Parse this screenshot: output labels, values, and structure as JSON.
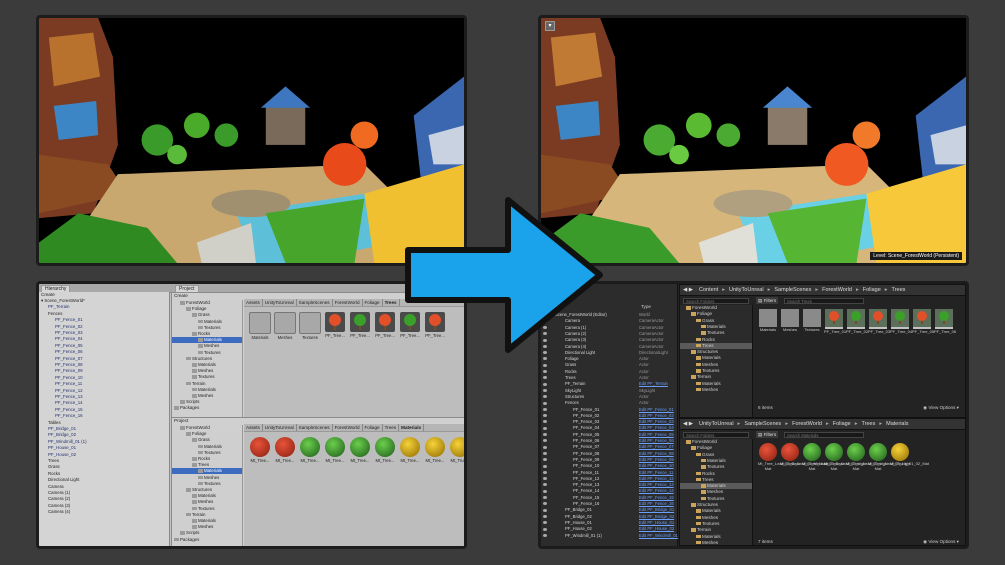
{
  "colors": {
    "background": "#3b3b3b",
    "arrow_fill": "#1aa2ea",
    "arrow_stroke": "#111111",
    "unity_bg": "#c2c2c2",
    "unreal_bg": "#262626",
    "selection": "#3d6bbf"
  },
  "viewport_right": {
    "level_label": "Level: Scene_ForestWorld (Persistent)"
  },
  "unity": {
    "hierarchy_tab": "Hierarchy",
    "create_label": "Create",
    "hierarchy": [
      {
        "label": "Scene_ForestWorld*",
        "dark": true
      },
      {
        "label": "PF_Terrain"
      },
      {
        "label": "Fences",
        "dark": true
      },
      {
        "label": "PF_Fence_01"
      },
      {
        "label": "PF_Fence_02"
      },
      {
        "label": "PF_Fence_03"
      },
      {
        "label": "PF_Fence_04"
      },
      {
        "label": "PF_Fence_05"
      },
      {
        "label": "PF_Fence_06"
      },
      {
        "label": "PF_Fence_07"
      },
      {
        "label": "PF_Fence_08"
      },
      {
        "label": "PF_Fence_09"
      },
      {
        "label": "PF_Fence_10"
      },
      {
        "label": "PF_Fence_11"
      },
      {
        "label": "PF_Fence_12"
      },
      {
        "label": "PF_Fence_13"
      },
      {
        "label": "PF_Fence_14"
      },
      {
        "label": "PF_Fence_15"
      },
      {
        "label": "PF_Fence_16"
      },
      {
        "label": "Tables",
        "dark": true
      },
      {
        "label": "PF_Bridge_01"
      },
      {
        "label": "PF_Bridge_02"
      },
      {
        "label": "PF_Windmill_01 (1)"
      },
      {
        "label": "PF_House_01"
      },
      {
        "label": "PF_House_02"
      },
      {
        "label": "Trees",
        "dark": true
      },
      {
        "label": "Grass",
        "dark": true
      },
      {
        "label": "Rocks",
        "dark": true
      },
      {
        "label": "Directional Light",
        "dark": true
      },
      {
        "label": "Camera",
        "dark": true
      },
      {
        "label": "Camera (1)",
        "dark": true
      },
      {
        "label": "Camera (2)",
        "dark": true
      },
      {
        "label": "Camera (3)",
        "dark": true
      },
      {
        "label": "Camera (4)",
        "dark": true
      }
    ],
    "project_tab": "Project",
    "project_top": {
      "tree": [
        {
          "label": "ForestWorld",
          "indent": 1
        },
        {
          "label": "Foliage",
          "indent": 2
        },
        {
          "label": "Grass",
          "indent": 3
        },
        {
          "label": "Materials",
          "indent": 4
        },
        {
          "label": "Textures",
          "indent": 4
        },
        {
          "label": "Rocks",
          "indent": 3
        },
        {
          "label": "Materials",
          "indent": 4,
          "sel": true
        },
        {
          "label": "Meshes",
          "indent": 4
        },
        {
          "label": "Textures",
          "indent": 4
        },
        {
          "label": "Structures",
          "indent": 2
        },
        {
          "label": "Materials",
          "indent": 3
        },
        {
          "label": "Meshes",
          "indent": 3
        },
        {
          "label": "Textures",
          "indent": 3
        },
        {
          "label": "Terrain",
          "indent": 2
        },
        {
          "label": "Materials",
          "indent": 3
        },
        {
          "label": "Meshes",
          "indent": 3
        },
        {
          "label": "Scripts",
          "indent": 1
        },
        {
          "label": "Packages",
          "indent": 0
        }
      ],
      "breadcrumb": [
        "Assets",
        "UnityToUnreal",
        "SampleScenes",
        "ForestWorld",
        "Foliage",
        "Trees"
      ],
      "assets": [
        {
          "label": "Materials",
          "kind": "folder"
        },
        {
          "label": "Meshes",
          "kind": "folder"
        },
        {
          "label": "Textures",
          "kind": "folder"
        },
        {
          "label": "PF_Tree...",
          "kind": "tree"
        },
        {
          "label": "PF_Tree...",
          "kind": "tree"
        },
        {
          "label": "PF_Tree...",
          "kind": "tree"
        },
        {
          "label": "PF_Tree...",
          "kind": "tree"
        },
        {
          "label": "PF_Tree...",
          "kind": "tree"
        }
      ]
    },
    "project_bottom": {
      "tree": [
        {
          "label": "ForestWorld",
          "indent": 1
        },
        {
          "label": "Foliage",
          "indent": 2
        },
        {
          "label": "Grass",
          "indent": 3
        },
        {
          "label": "Materials",
          "indent": 4
        },
        {
          "label": "Textures",
          "indent": 4
        },
        {
          "label": "Rocks",
          "indent": 3
        },
        {
          "label": "Trees",
          "indent": 3
        },
        {
          "label": "Materials",
          "indent": 4,
          "sel": true
        },
        {
          "label": "Meshes",
          "indent": 4
        },
        {
          "label": "Textures",
          "indent": 4
        },
        {
          "label": "Structures",
          "indent": 2
        },
        {
          "label": "Materials",
          "indent": 3
        },
        {
          "label": "Meshes",
          "indent": 3
        },
        {
          "label": "Textures",
          "indent": 3
        },
        {
          "label": "Terrain",
          "indent": 2
        },
        {
          "label": "Materials",
          "indent": 3
        },
        {
          "label": "Meshes",
          "indent": 3
        },
        {
          "label": "Scripts",
          "indent": 1
        },
        {
          "label": "Packages",
          "indent": 0
        }
      ],
      "breadcrumb": [
        "Assets",
        "UnityToUnreal",
        "SampleScenes",
        "ForestWorld",
        "Foliage",
        "Trees",
        "Materials"
      ],
      "assets": [
        {
          "label": "Mt_Tree...",
          "kind": "red"
        },
        {
          "label": "Mt_Tree...",
          "kind": "red"
        },
        {
          "label": "Mt_Tree...",
          "kind": "grn"
        },
        {
          "label": "Mt_Tree...",
          "kind": "grn"
        },
        {
          "label": "Mt_Tree...",
          "kind": "grn"
        },
        {
          "label": "Mt_Tree...",
          "kind": "grn"
        },
        {
          "label": "Mt_Tree...",
          "kind": "yel"
        },
        {
          "label": "Mt_Tree...",
          "kind": "yel"
        },
        {
          "label": "Mt_Trun...",
          "kind": "yel"
        }
      ]
    }
  },
  "unreal": {
    "outliner_header": "Type",
    "outliner": [
      {
        "label": "Scene_ForestWorld (Editor)",
        "type": "World"
      },
      {
        "label": "Camera",
        "type": "CameraActor"
      },
      {
        "label": "Camera (1)",
        "type": "CameraActor"
      },
      {
        "label": "Camera (2)",
        "type": "CameraActor"
      },
      {
        "label": "Camera (3)",
        "type": "CameraActor"
      },
      {
        "label": "Camera (4)",
        "type": "CameraActor"
      },
      {
        "label": "Directional Light",
        "type": "DirectionalLight"
      },
      {
        "label": "Foliage",
        "type": "Actor"
      },
      {
        "label": "Grass",
        "type": "Actor"
      },
      {
        "label": "Rocks",
        "type": "Actor"
      },
      {
        "label": "Trees",
        "type": "Actor"
      },
      {
        "label": "PF_Terrain",
        "type": "Edit PF_Terrain",
        "link": true
      },
      {
        "label": "SkyLight",
        "type": "SkyLight"
      },
      {
        "label": "Structures",
        "type": "Actor"
      },
      {
        "label": "Fences",
        "type": "Actor"
      },
      {
        "label": "PF_Fence_01",
        "type": "Edit PF_Fence_01",
        "link": true
      },
      {
        "label": "PF_Fence_02",
        "type": "Edit PF_Fence_02",
        "link": true
      },
      {
        "label": "PF_Fence_03",
        "type": "Edit PF_Fence_03",
        "link": true
      },
      {
        "label": "PF_Fence_04",
        "type": "Edit PF_Fence_04",
        "link": true
      },
      {
        "label": "PF_Fence_05",
        "type": "Edit PF_Fence_05",
        "link": true
      },
      {
        "label": "PF_Fence_06",
        "type": "Edit PF_Fence_06",
        "link": true
      },
      {
        "label": "PF_Fence_07",
        "type": "Edit PF_Fence_07",
        "link": true
      },
      {
        "label": "PF_Fence_08",
        "type": "Edit PF_Fence_08",
        "link": true
      },
      {
        "label": "PF_Fence_09",
        "type": "Edit PF_Fence_09",
        "link": true
      },
      {
        "label": "PF_Fence_10",
        "type": "Edit PF_Fence_10",
        "link": true
      },
      {
        "label": "PF_Fence_11",
        "type": "Edit PF_Fence_11",
        "link": true
      },
      {
        "label": "PF_Fence_12",
        "type": "Edit PF_Fence_12",
        "link": true
      },
      {
        "label": "PF_Fence_13",
        "type": "Edit PF_Fence_13",
        "link": true
      },
      {
        "label": "PF_Fence_14",
        "type": "Edit PF_Fence_14",
        "link": true
      },
      {
        "label": "PF_Fence_15",
        "type": "Edit PF_Fence_15",
        "link": true
      },
      {
        "label": "PF_Fence_16",
        "type": "Edit PF_Fence_16",
        "link": true
      },
      {
        "label": "PF_Bridge_01",
        "type": "Edit PF_Bridge_01",
        "link": true
      },
      {
        "label": "PF_Bridge_02",
        "type": "Edit PF_Bridge_02",
        "link": true
      },
      {
        "label": "PF_House_01",
        "type": "Edit PF_House_01",
        "link": true
      },
      {
        "label": "PF_House_02",
        "type": "Edit PF_House_02",
        "link": true
      },
      {
        "label": "PF_Windmill_01 (1)",
        "type": "Edit PF_Windmill_01",
        "link": true
      }
    ],
    "cb_top": {
      "breadcrumb": [
        "Content",
        "UnityToUnreal",
        "SampleScenes",
        "ForestWorld",
        "Foliage",
        "Trees"
      ],
      "search_folders": "Search Folders",
      "filters": "Filters",
      "search_assets": "Search Trees",
      "tree": [
        {
          "label": "ForestWorld",
          "indent": 1
        },
        {
          "label": "Foliage",
          "indent": 2
        },
        {
          "label": "Grass",
          "indent": 3
        },
        {
          "label": "Materials",
          "indent": 4
        },
        {
          "label": "Textures",
          "indent": 4
        },
        {
          "label": "Rocks",
          "indent": 3
        },
        {
          "label": "Trees",
          "indent": 3,
          "sel": true
        },
        {
          "label": "Structures",
          "indent": 2
        },
        {
          "label": "Materials",
          "indent": 3
        },
        {
          "label": "Meshes",
          "indent": 3
        },
        {
          "label": "Textures",
          "indent": 3
        },
        {
          "label": "Terrain",
          "indent": 2
        },
        {
          "label": "Materials",
          "indent": 3
        },
        {
          "label": "Meshes",
          "indent": 3
        }
      ],
      "assets": [
        {
          "label": "Materials",
          "kind": "folder"
        },
        {
          "label": "Meshes",
          "kind": "folder"
        },
        {
          "label": "Textures",
          "kind": "folder"
        },
        {
          "label": "PF_Tree_01",
          "kind": "tree"
        },
        {
          "label": "PF_Tree_02",
          "kind": "tree"
        },
        {
          "label": "PF_Tree_03",
          "kind": "tree"
        },
        {
          "label": "PF_Tree_04",
          "kind": "tree"
        },
        {
          "label": "PF_Tree_05",
          "kind": "tree"
        },
        {
          "label": "PF_Tree_06",
          "kind": "tree"
        }
      ],
      "count": "6 items",
      "view_options": "View Options"
    },
    "cb_bottom": {
      "breadcrumb": [
        "UnityToUnreal",
        "SampleScenes",
        "ForestWorld",
        "Foliage",
        "Trees",
        "Materials"
      ],
      "search_folders": "Search Folders",
      "filters": "Filters",
      "search_assets": "Search Materials",
      "tree": [
        {
          "label": "ForestWorld",
          "indent": 1
        },
        {
          "label": "Foliage",
          "indent": 2
        },
        {
          "label": "Grass",
          "indent": 3
        },
        {
          "label": "Materials",
          "indent": 4
        },
        {
          "label": "Textures",
          "indent": 4
        },
        {
          "label": "Rocks",
          "indent": 3
        },
        {
          "label": "Trees",
          "indent": 3
        },
        {
          "label": "Materials",
          "indent": 4,
          "sel": true
        },
        {
          "label": "Meshes",
          "indent": 4
        },
        {
          "label": "Textures",
          "indent": 4
        },
        {
          "label": "Structures",
          "indent": 2
        },
        {
          "label": "Materials",
          "indent": 3
        },
        {
          "label": "Meshes",
          "indent": 3
        },
        {
          "label": "Textures",
          "indent": 3
        },
        {
          "label": "Terrain",
          "indent": 2
        },
        {
          "label": "Materials",
          "indent": 3
        },
        {
          "label": "Meshes",
          "indent": 3
        }
      ],
      "assets": [
        {
          "label": "Mt_Tree_Leaf_01_Dark Mat",
          "kind": "red"
        },
        {
          "label": "Mt_Tree_Leaf_01_Medium",
          "kind": "red"
        },
        {
          "label": "Mt_Tree_Leaf_02_Dark Mat",
          "kind": "grn"
        },
        {
          "label": "Mt_Tree_Leaf_02_Light Mat",
          "kind": "grn"
        },
        {
          "label": "Mt_Tree_Leaf_02_Light Mat",
          "kind": "grn"
        },
        {
          "label": "Mt_Tree_Leaf_03_Light Mat",
          "kind": "grn"
        },
        {
          "label": "Mt_Trunk_01_02_Mat",
          "kind": "yel"
        }
      ],
      "count": "7 items",
      "view_options": "View Options"
    }
  }
}
